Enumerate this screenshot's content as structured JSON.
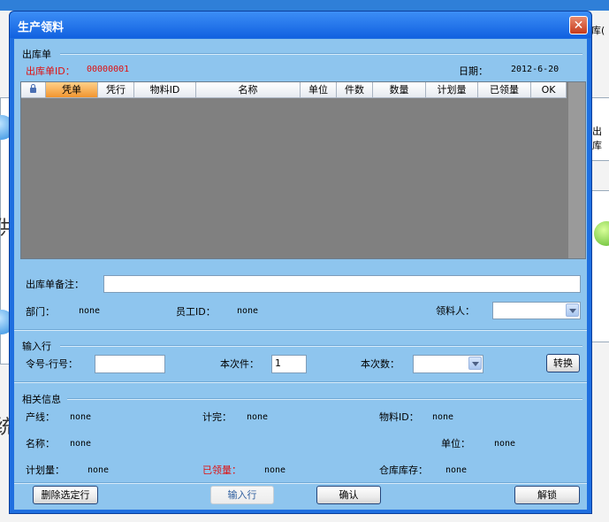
{
  "background": {
    "right_label_1": "库(",
    "right_label_2": "出库",
    "left_glyph_1": "供",
    "left_glyph_2": "统"
  },
  "dialog": {
    "title": "生产领料",
    "close_label": "✕"
  },
  "outbound": {
    "group_title": "出库单",
    "id_label": "出库单ID：",
    "id_value": "00000001",
    "date_label": "日期：",
    "date_value": "2012-6-20",
    "columns": [
      "凭单",
      "凭行",
      "物料ID",
      "名称",
      "单位",
      "件数",
      "数量",
      "计划量",
      "已领量",
      "OK"
    ],
    "remark_label": "出库单备注：",
    "remark_value": "",
    "dept_label": "部门：",
    "dept_value": "none",
    "employee_label": "员工ID：",
    "employee_value": "none",
    "receiver_label": "领料人：",
    "receiver_value": ""
  },
  "input_row": {
    "group_title": "输入行",
    "order_label": "令号-行号：",
    "order_value": "",
    "pieces_label": "本次件：",
    "pieces_value": "1",
    "qty_label": "本次数：",
    "qty_value": "",
    "convert_label": "转换"
  },
  "related": {
    "group_title": "相关信息",
    "line_label": "产线：",
    "line_value": "none",
    "done_label": "计完：",
    "done_value": "none",
    "material_label": "物料ID：",
    "material_value": "none",
    "name_label": "名称：",
    "name_value": "none",
    "unit_label": "单位：",
    "unit_value": "none",
    "plan_label": "计划量：",
    "plan_value": "none",
    "received_label": "已领量：",
    "received_value": "none",
    "stock_label": "仓库库存：",
    "stock_value": "none"
  },
  "footer": {
    "delete_label": "删除选定行",
    "input_label": "输入行",
    "confirm_label": "确认",
    "unlock_label": "解锁"
  },
  "colors": {
    "dialog_frame": "#1f6fe0",
    "client_bg": "#8ec5ee",
    "grid_bg": "#808080",
    "accent_red": "#e01010",
    "active_header": "#f1952f"
  }
}
